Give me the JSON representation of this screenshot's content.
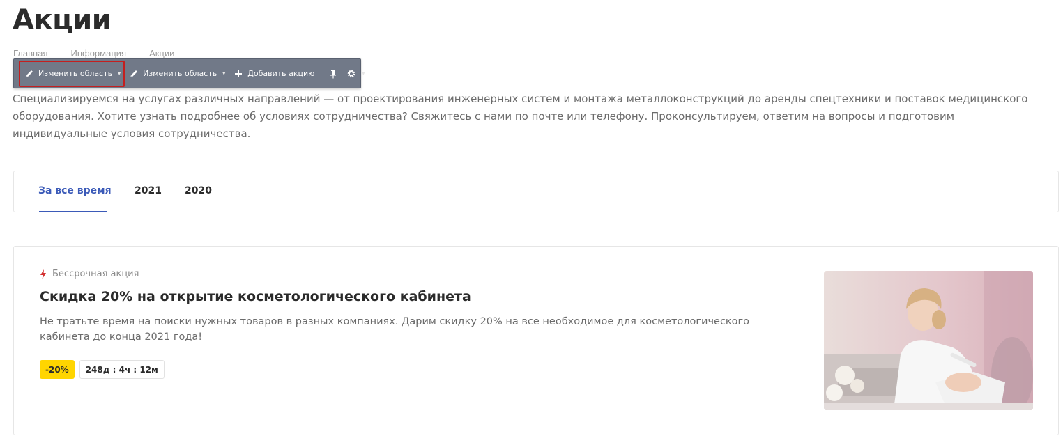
{
  "page": {
    "title": "Акции"
  },
  "breadcrumb": {
    "items": [
      "Главная",
      "Информация",
      "Акции"
    ],
    "separator": "—"
  },
  "admin_toolbar": {
    "edit_area_1": "Изменить область",
    "edit_area_2": "Изменить область",
    "add_promo": "Добавить акцию",
    "caret": "▾"
  },
  "intro": {
    "text": "Специализируемся на услугах различных направлений — от проектирования инженерных систем и монтажа металлоконструкций до аренды спецтехники и поставок медицинского оборудования. Хотите узнать подробнее об условиях сотрудничества? Свяжитесь с нами по почте или телефону. Проконсультируем, ответим на вопросы и подготовим индивидуальные условия сотрудничества."
  },
  "tabs": {
    "items": [
      {
        "label": "За все время"
      },
      {
        "label": "2021"
      },
      {
        "label": "2020"
      }
    ],
    "active_index": 0
  },
  "promo": {
    "badge": "Бессрочная акция",
    "title": "Скидка 20% на открытие косметологического кабинета",
    "description": "Не тратьте время на поиски нужных товаров в разных компаниях. Дарим скидку 20% на все необходимое для косметологического кабинета до конца 2021 года!",
    "discount": "-20%",
    "timer": "248д : 4ч : 12м"
  },
  "colors": {
    "accent": "#3b5ab8",
    "badge_bolt": "#d32f2f",
    "discount_bg": "#ffd500",
    "toolbar_bg": "#717988",
    "toolbar_highlight": "#c41f1f"
  }
}
